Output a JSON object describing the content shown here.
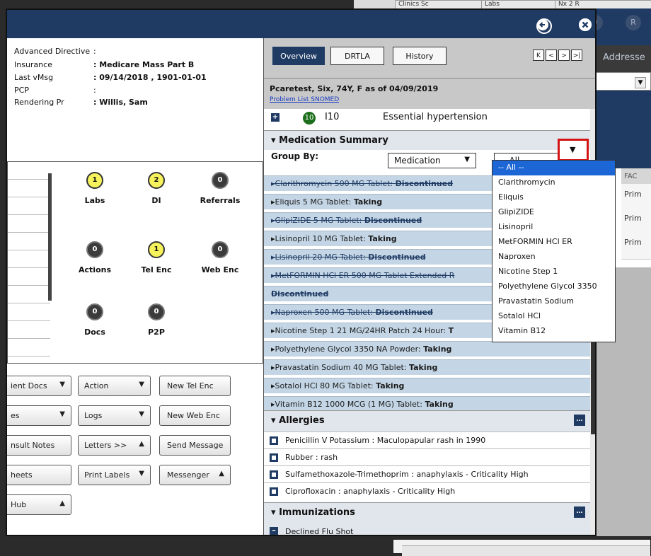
{
  "background": {
    "top_tabs": [
      "Clinics Sc",
      "Labs",
      "Nx 2 R"
    ],
    "header_circles": [
      "0",
      "R"
    ],
    "addressed_label": "Addresse",
    "table_header": "FAC",
    "table_rows": [
      "Prim",
      "Prim",
      "Prim"
    ]
  },
  "patient_info": {
    "rows": [
      {
        "label": "Advanced Directive",
        "value": ":"
      },
      {
        "label": "Insurance",
        "value": ": Medicare Mass Part B"
      },
      {
        "label": "Last vMsg",
        "value": ": 09/14/2018 , 1901-01-01"
      },
      {
        "label": "PCP",
        "value": ":"
      },
      {
        "label": "Rendering Pr",
        "value": ": Willis, Sam"
      }
    ]
  },
  "tiles": [
    {
      "label": "Labs",
      "count": "1",
      "style": "yellow"
    },
    {
      "label": "DI",
      "count": "2",
      "style": "yellow"
    },
    {
      "label": "Referrals",
      "count": "0",
      "style": "dark"
    },
    {
      "label": "Actions",
      "count": "0",
      "style": "dark"
    },
    {
      "label": "Tel Enc",
      "count": "1",
      "style": "yellow"
    },
    {
      "label": "Web Enc",
      "count": "0",
      "style": "dark"
    },
    {
      "label": "Docs",
      "count": "0",
      "style": "dark"
    },
    {
      "label": "P2P",
      "count": "0",
      "style": "dark"
    }
  ],
  "buttons": {
    "patient_docs": "ient Docs",
    "action": "Action",
    "new_tel_enc": "New Tel Enc",
    "es": "es",
    "logs": "Logs",
    "new_web_enc": "New Web Enc",
    "consult_notes": "nsult Notes",
    "letters": "Letters  >>",
    "send_message": "Send Message",
    "sheets": "heets",
    "print_labels": "Print Labels",
    "messenger": "Messenger",
    "hub": "Hub"
  },
  "tabs": [
    "Overview",
    "DRTLA",
    "History"
  ],
  "nav_buttons": [
    "K",
    "<",
    ">",
    ">|"
  ],
  "patient_line": "Pcaretest, Six, 74Y, F as of 04/09/2019",
  "problem_list_link": "Problem List SNOMED",
  "problem": {
    "count": "10",
    "code": "I10",
    "description": "Essential hypertension"
  },
  "medication_summary": {
    "title": "Medication Summary",
    "group_by_label": "Group By:",
    "group_by_value": "Medication",
    "filter_value": "-- All --",
    "items": [
      {
        "name": "Clarithromycin 500 MG Tablet: ",
        "status": "Discontinued",
        "discontinued": true
      },
      {
        "name": "Eliquis 5 MG Tablet: ",
        "status": "Taking",
        "discontinued": false
      },
      {
        "name": "GlipiZIDE 5 MG Tablet: ",
        "status": "Discontinued",
        "discontinued": true
      },
      {
        "name": "Lisinopril 10 MG Tablet: ",
        "status": "Taking",
        "discontinued": false
      },
      {
        "name": "Lisinopril 20 MG Tablet: ",
        "status": "Discontinued",
        "discontinued": true
      },
      {
        "name": "MetFORMIN HCl ER 500 MG Tablet Extended R",
        "status": "",
        "discontinued": true
      },
      {
        "name": "",
        "status": "Discontinued",
        "discontinued": true
      },
      {
        "name": "Naproxen 500 MG Tablet: ",
        "status": "Discontinued",
        "discontinued": true
      },
      {
        "name": "Nicotine Step 1 21 MG/24HR Patch 24 Hour: ",
        "status": "T",
        "discontinued": false
      },
      {
        "name": "Polyethylene Glycol 3350 NA Powder: ",
        "status": "Taking",
        "discontinued": false
      },
      {
        "name": "Pravastatin Sodium 40 MG Tablet: ",
        "status": "Taking",
        "discontinued": false
      },
      {
        "name": "Sotalol HCl 80 MG Tablet: ",
        "status": "Taking",
        "discontinued": false
      },
      {
        "name": "Vitamin B12 1000 MCG (1 MG) Tablet: ",
        "status": "Taking",
        "discontinued": false
      }
    ]
  },
  "allergies": {
    "title": "Allergies",
    "items": [
      "Penicillin V Potassium : Maculopapular rash in 1990",
      "Rubber : rash",
      "Sulfamethoxazole-Trimethoprim : anaphylaxis - Criticality High",
      "Ciprofloxacin : anaphylaxis - Criticality High"
    ]
  },
  "immunizations": {
    "title": "Immunizations",
    "items": [
      "Declined Flu Shot"
    ]
  },
  "dropdown_options": [
    "-- All --",
    "Clarithromycin",
    "Eliquis",
    "GlipiZIDE",
    "Lisinopril",
    "MetFORMIN HCl ER",
    "Naproxen",
    "Nicotine Step 1",
    "Polyethylene Glycol 3350",
    "Pravastatin Sodium",
    "Sotalol HCl",
    "Vitamin B12"
  ],
  "colors": {
    "header_navy": "#1f3b63",
    "med_row": "#c4d6e6",
    "highlight_red": "#d41414",
    "selected_option": "#1c66d6"
  }
}
